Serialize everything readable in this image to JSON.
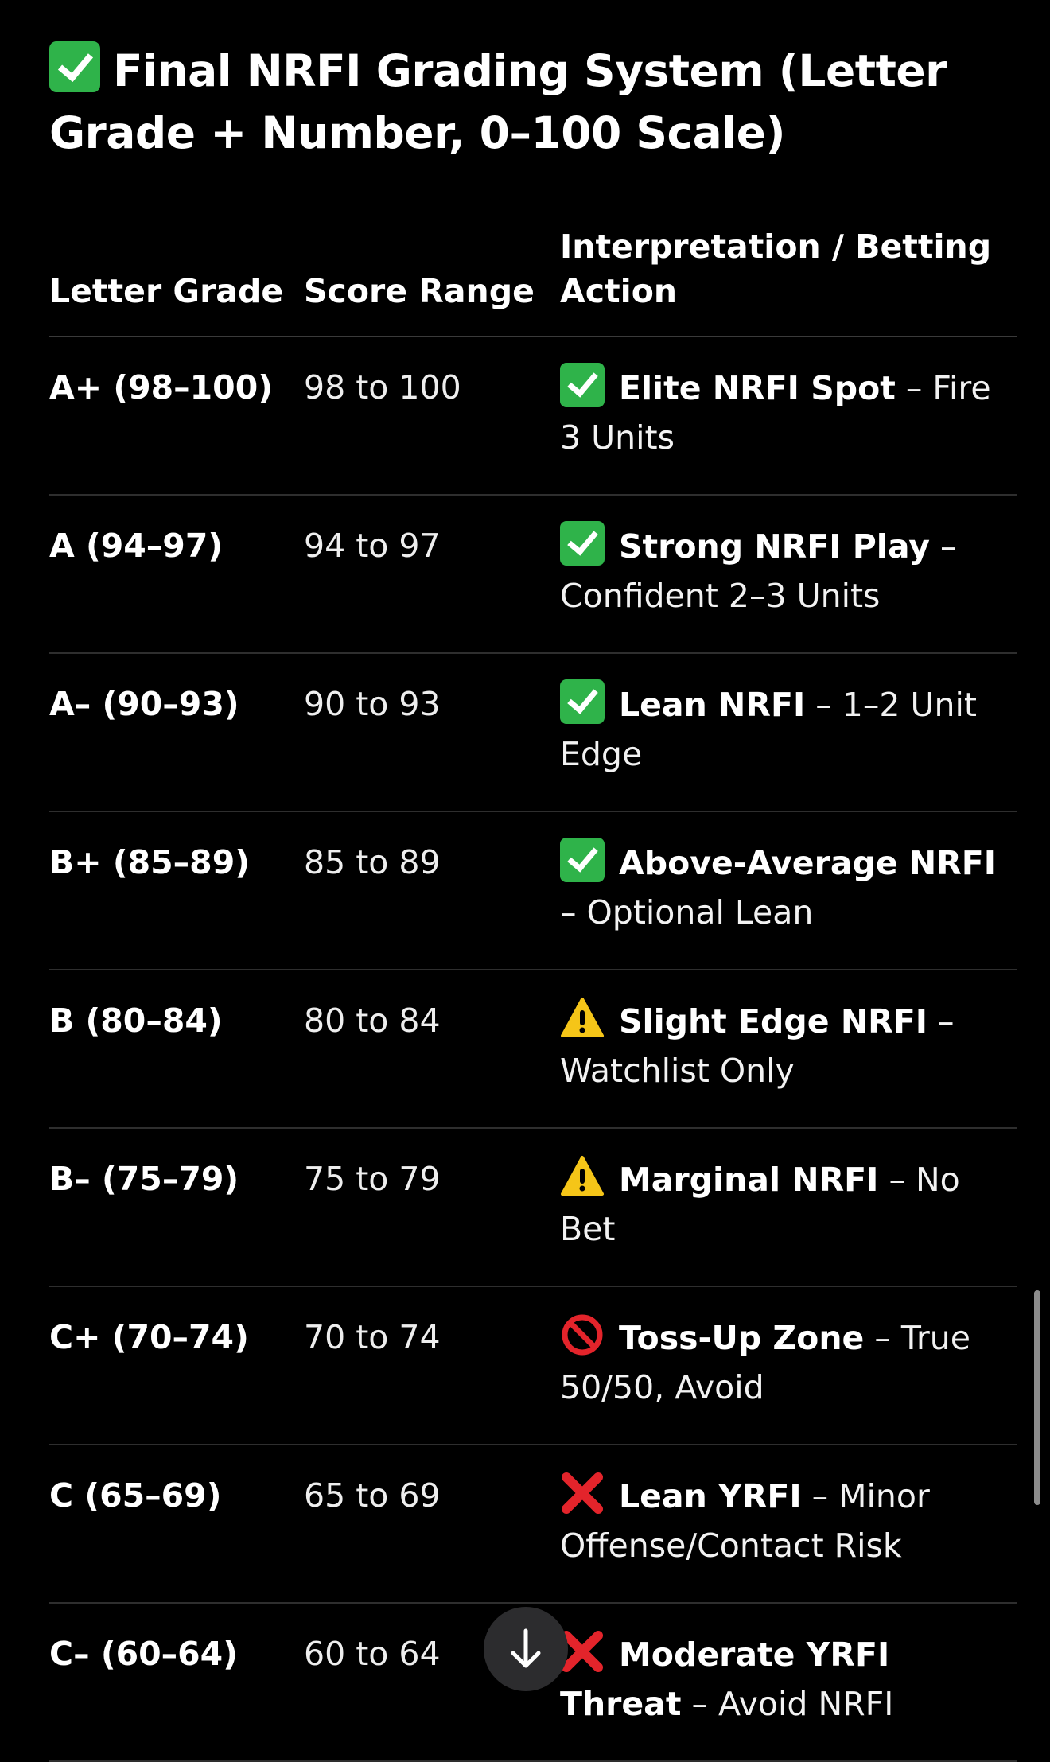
{
  "heading": {
    "icon": "check-mark-button-icon",
    "text": "Final NRFI Grading System (Letter Grade + Number, 0–100 Scale)"
  },
  "table": {
    "headers": [
      "Letter Grade",
      "Score Range",
      "Interpretation / Betting Action"
    ],
    "rows": [
      {
        "grade": "A+ (98–100)",
        "range": "98 to 100",
        "icon": "check-mark-button-icon",
        "title": "Elite NRFI Spot",
        "detail": " – Fire 3 Units"
      },
      {
        "grade": "A (94–97)",
        "range": "94 to 97",
        "icon": "check-mark-button-icon",
        "title": "Strong NRFI Play",
        "detail": " – Confident 2–3 Units"
      },
      {
        "grade": "A– (90–93)",
        "range": "90 to 93",
        "icon": "check-mark-button-icon",
        "title": "Lean NRFI",
        "detail": " – 1–2 Unit Edge"
      },
      {
        "grade": "B+ (85–89)",
        "range": "85 to 89",
        "icon": "check-mark-button-icon",
        "title": "Above-Average NRFI",
        "detail": " – Optional Lean"
      },
      {
        "grade": "B (80–84)",
        "range": "80 to 84",
        "icon": "warning-icon",
        "title": "Slight Edge NRFI",
        "detail": " – Watchlist Only"
      },
      {
        "grade": "B– (75–79)",
        "range": "75 to 79",
        "icon": "warning-icon",
        "title": "Marginal NRFI",
        "detail": " – No Bet"
      },
      {
        "grade": "C+ (70–74)",
        "range": "70 to 74",
        "icon": "prohibited-icon",
        "title": "Toss-Up Zone",
        "detail": " – True 50/50, Avoid"
      },
      {
        "grade": "C (65–69)",
        "range": "65 to 69",
        "icon": "cross-mark-icon",
        "title": "Lean YRFI",
        "detail": " – Minor Offense/Contact Risk"
      },
      {
        "grade": "C– (60–64)",
        "range": "60 to 64",
        "icon": "cross-mark-icon",
        "title": "Moderate YRFI Threat",
        "detail": " – Avoid NRFI"
      }
    ]
  },
  "controls": {
    "scroll_down_icon": "arrow-down-icon"
  },
  "colors": {
    "background": "#000000",
    "check_green": "#2fb34a",
    "warning_yellow": "#f5c518",
    "cross_red": "#e3242b"
  }
}
